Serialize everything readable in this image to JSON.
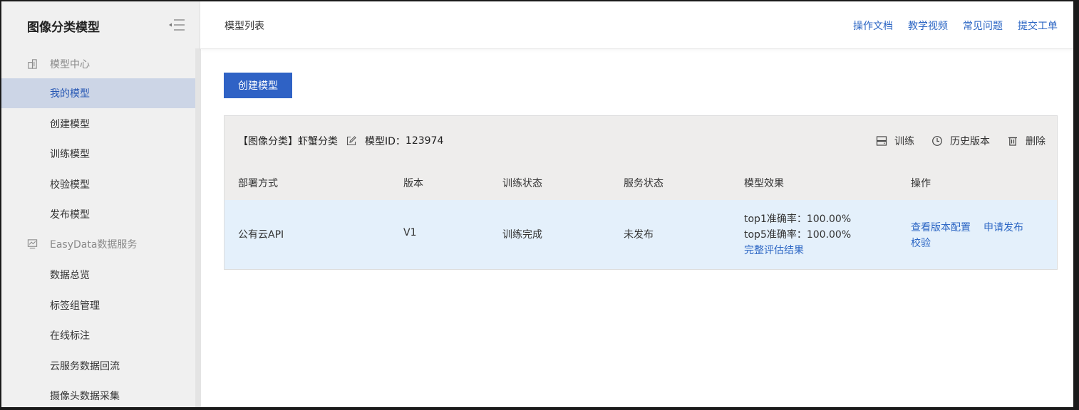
{
  "sidebar": {
    "title": "图像分类模型",
    "groups": [
      {
        "label": "模型中心",
        "icon": "building-icon",
        "items": [
          {
            "label": "我的模型",
            "active": true
          },
          {
            "label": "创建模型"
          },
          {
            "label": "训练模型"
          },
          {
            "label": "校验模型"
          },
          {
            "label": "发布模型"
          }
        ]
      },
      {
        "label": "EasyData数据服务",
        "icon": "data-chart-icon",
        "items": [
          {
            "label": "数据总览"
          },
          {
            "label": "标签组管理"
          },
          {
            "label": "在线标注"
          },
          {
            "label": "云服务数据回流"
          },
          {
            "label": "摄像头数据采集"
          }
        ]
      }
    ]
  },
  "header": {
    "breadcrumb": "模型列表",
    "links": [
      "操作文档",
      "教学视频",
      "常见问题",
      "提交工单"
    ]
  },
  "main": {
    "create_button": "创建模型",
    "model": {
      "title": "【图像分类】虾蟹分类",
      "id_label": "模型ID：",
      "id_value": "123974",
      "actions": [
        "训练",
        "历史版本",
        "删除"
      ],
      "columns": [
        "部署方式",
        "版本",
        "训练状态",
        "服务状态",
        "模型效果",
        "操作"
      ],
      "row": {
        "deploy": "公有云API",
        "version": "V1",
        "train_status": "训练完成",
        "service_status": "未发布",
        "top1": "top1准确率：100.00%",
        "top5": "top5准确率：100.00%",
        "eval_link": "完整评估结果",
        "ops": [
          "查看版本配置",
          "申请发布",
          "校验"
        ]
      }
    }
  },
  "colors": {
    "accent": "#2f62c5",
    "link": "#2c66c4",
    "active_nav_bg": "#ccd5e6",
    "row_highlight": "#e4f0fb"
  }
}
